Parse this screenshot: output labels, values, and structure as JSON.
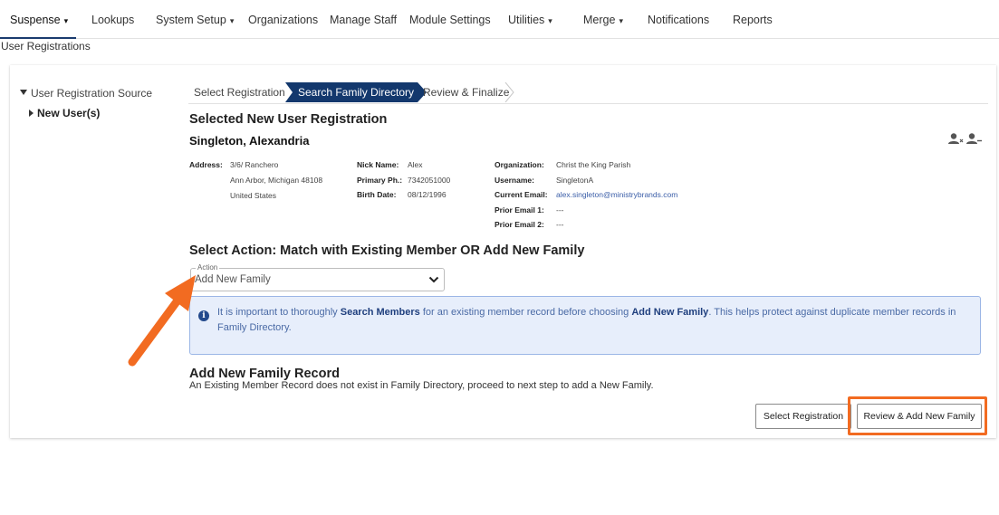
{
  "nav": {
    "items": [
      {
        "label": "Suspense",
        "has_caret": true
      },
      {
        "label": "Lookups",
        "has_caret": false
      },
      {
        "label": "System Setup",
        "has_caret": true
      },
      {
        "label": "Organizations",
        "has_caret": false
      },
      {
        "label": "Manage Staff",
        "has_caret": false
      },
      {
        "label": "Module Settings",
        "has_caret": false
      },
      {
        "label": "Utilities",
        "has_caret": true
      },
      {
        "label": "Merge",
        "has_caret": true
      },
      {
        "label": "Notifications",
        "has_caret": false
      },
      {
        "label": "Reports",
        "has_caret": false
      }
    ],
    "caret": "▾"
  },
  "page_label": "User Registrations",
  "tree": {
    "root": "User Registration Source",
    "child": "New User(s)"
  },
  "steps": [
    {
      "label": "Select Registration",
      "active": false
    },
    {
      "label": "Search Family Directory",
      "active": true
    },
    {
      "label": "Review & Finalize",
      "active": false
    }
  ],
  "registration": {
    "section_title": "Selected New User Registration",
    "name": "Singleton, Alexandria",
    "address_label": "Address:",
    "address_line1": "3/6/ Ranchero",
    "address_line2": "Ann Arbor, Michigan 48108",
    "address_line3": "United States",
    "nick_label": "Nick Name:",
    "nick_value": "Alex",
    "phone_label": "Primary Ph.:",
    "phone_value": "7342051000",
    "birth_label": "Birth Date:",
    "birth_value": "08/12/1996",
    "org_label": "Organization:",
    "org_value": "Christ the King Parish",
    "username_label": "Username:",
    "username_value": "SingletonA",
    "email_label": "Current Email:",
    "email_value": "alex.singleton@ministrybrands.com",
    "prior1_label": "Prior Email 1:",
    "prior1_value": "---",
    "prior2_label": "Prior Email 2:",
    "prior2_value": "---"
  },
  "action": {
    "title": "Select Action: Match with Existing Member OR Add New Family",
    "select_legend": "Action",
    "select_value": "Add New Family"
  },
  "info": {
    "icon": "i",
    "text_1": "It is important to thoroughly ",
    "bold_1": "Search Members",
    "text_2": " for an existing member record before choosing ",
    "bold_2": "Add New Family",
    "text_3": ". This helps protect against duplicate member records in Family Directory."
  },
  "add_family": {
    "title": "Add New Family Record",
    "description": "An Existing Member Record does not exist in Family Directory, proceed to next step to add a New Family."
  },
  "buttons": {
    "select_registration": "Select Registration",
    "review_add": "Review & Add New Family"
  },
  "colors": {
    "accent_dark": "#13386d",
    "annotation_orange": "#f26b21",
    "info_bg": "#e7eefb"
  }
}
